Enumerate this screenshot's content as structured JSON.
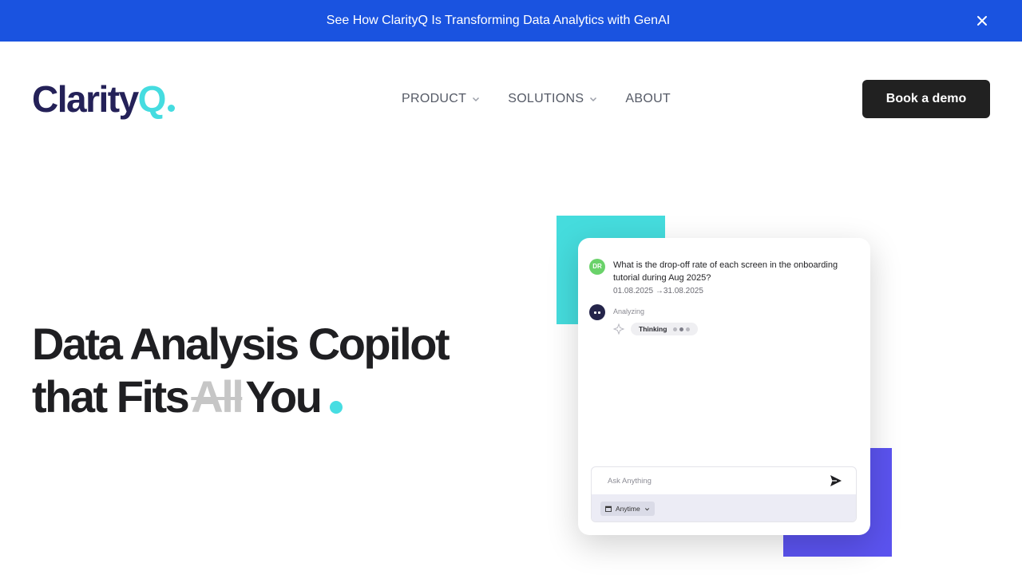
{
  "announcement": {
    "text": "See How ClarityQ Is Transforming Data Analytics with GenAI",
    "close_icon": "close-icon",
    "background": "#1a53e0"
  },
  "header": {
    "logo": {
      "main": "Clarity",
      "accent": "Q",
      "main_color": "#242158",
      "accent_color": "#45dce0"
    },
    "nav": [
      {
        "label": "PRODUCT",
        "has_dropdown": true
      },
      {
        "label": "SOLUTIONS",
        "has_dropdown": true
      },
      {
        "label": "ABOUT",
        "has_dropdown": false
      }
    ],
    "cta_label": "Book a demo"
  },
  "hero": {
    "line1": "Data Analysis Copilot",
    "line2_prefix": "that Fits",
    "line2_struck": "All",
    "line2_suffix": "You",
    "accent_color": "#47dde2"
  },
  "chat_preview": {
    "user_avatar": "DR",
    "question": "What is the drop-off rate of each screen in the onboarding tutorial during Aug 2025?",
    "date_range": "01.08.2025 →31.08.2025",
    "status": "Analyzing",
    "thinking_label": "Thinking",
    "input_placeholder": "Ask Anything",
    "time_filter": "Anytime",
    "icons": [
      "sparkle-icon",
      "send-icon",
      "calendar-icon",
      "chevron-down-icon"
    ]
  },
  "colors": {
    "teal_block": "#45dcdd",
    "purple_block": "#5b53ef",
    "button_dark": "#212121"
  }
}
